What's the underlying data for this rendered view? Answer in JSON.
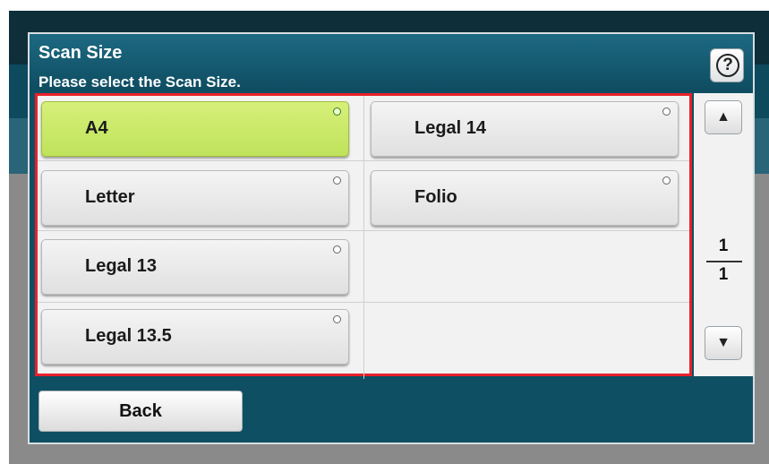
{
  "header": {
    "title": "Scan Size",
    "subtitle": "Please select the Scan Size.",
    "help_glyph": "?"
  },
  "sizes": [
    {
      "label": "A4",
      "selected": true
    },
    {
      "label": "Legal 14",
      "selected": false
    },
    {
      "label": "Letter",
      "selected": false
    },
    {
      "label": "Folio",
      "selected": false
    },
    {
      "label": "Legal 13",
      "selected": false
    },
    {
      "label": "Legal 13.5",
      "selected": false
    }
  ],
  "pagination": {
    "current": "1",
    "total": "1",
    "up_glyph": "▲",
    "down_glyph": "▼"
  },
  "footer": {
    "back_label": "Back"
  },
  "colors": {
    "selected": "#c8e86a",
    "highlight_border": "#e8202a",
    "header_bg": "#0f4f64"
  }
}
